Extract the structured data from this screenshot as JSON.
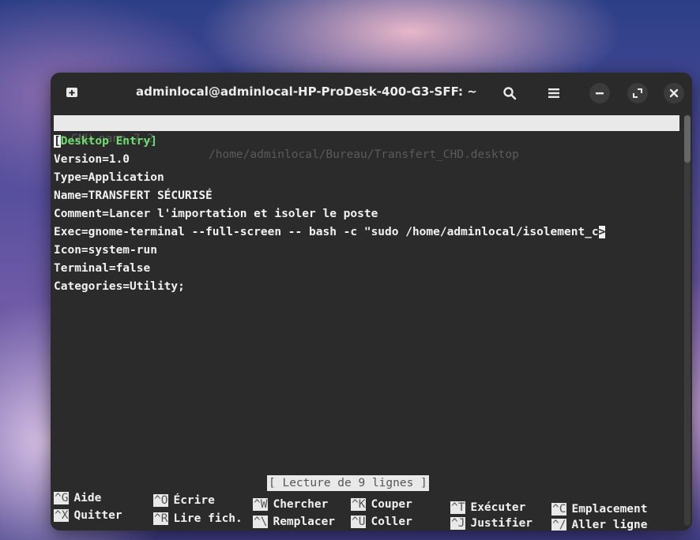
{
  "window": {
    "title": "adminlocal@adminlocal-HP-ProDesk-400-G3-SFF: ~",
    "buttons": {
      "new_tab_icon": "new-tab-icon",
      "search_icon": "search-icon",
      "menu_icon": "hamburger-menu-icon",
      "minimize_icon": "minimize-icon",
      "maximize_icon": "maximize-icon",
      "close_icon": "close-icon"
    }
  },
  "nano": {
    "version": "GNU nano 7.2",
    "file_path": "/home/adminlocal/Bureau/Transfert_CHD.desktop",
    "cursor_char": "[",
    "first_line_rest": "Desktop Entry]",
    "lines": [
      "Version=1.0",
      "Type=Application",
      "Name=TRANSFERT SÉCURISÉ",
      "Comment=Lancer l'importation et isoler le poste",
      "Exec=gnome-terminal --full-screen -- bash -c \"sudo /home/adminlocal/isolement_c",
      "Icon=system-run",
      "Terminal=false",
      "Categories=Utility;"
    ],
    "line_overflow_marker": ">",
    "status_message": "[ Lecture de 9 lignes ]",
    "shortcuts_row1": [
      {
        "key": "^G",
        "label": "Aide"
      },
      {
        "key": "^O",
        "label": "Écrire"
      },
      {
        "key": "^W",
        "label": "Chercher"
      },
      {
        "key": "^K",
        "label": "Couper"
      },
      {
        "key": "^T",
        "label": "Exécuter"
      },
      {
        "key": "^C",
        "label": "Emplacement"
      }
    ],
    "shortcuts_row2": [
      {
        "key": "^X",
        "label": "Quitter"
      },
      {
        "key": "^R",
        "label": "Lire fich."
      },
      {
        "key": "^\\",
        "label": "Remplacer"
      },
      {
        "key": "^U",
        "label": "Coller"
      },
      {
        "key": "^J",
        "label": "Justifier"
      },
      {
        "key": "^/",
        "label": "Aller ligne"
      }
    ]
  },
  "colors": {
    "terminal_bg": "#2b2b2b",
    "text": "#f2f2f2",
    "section_header": "#6fe06f",
    "inverse_bar": "#e9e9e9"
  }
}
